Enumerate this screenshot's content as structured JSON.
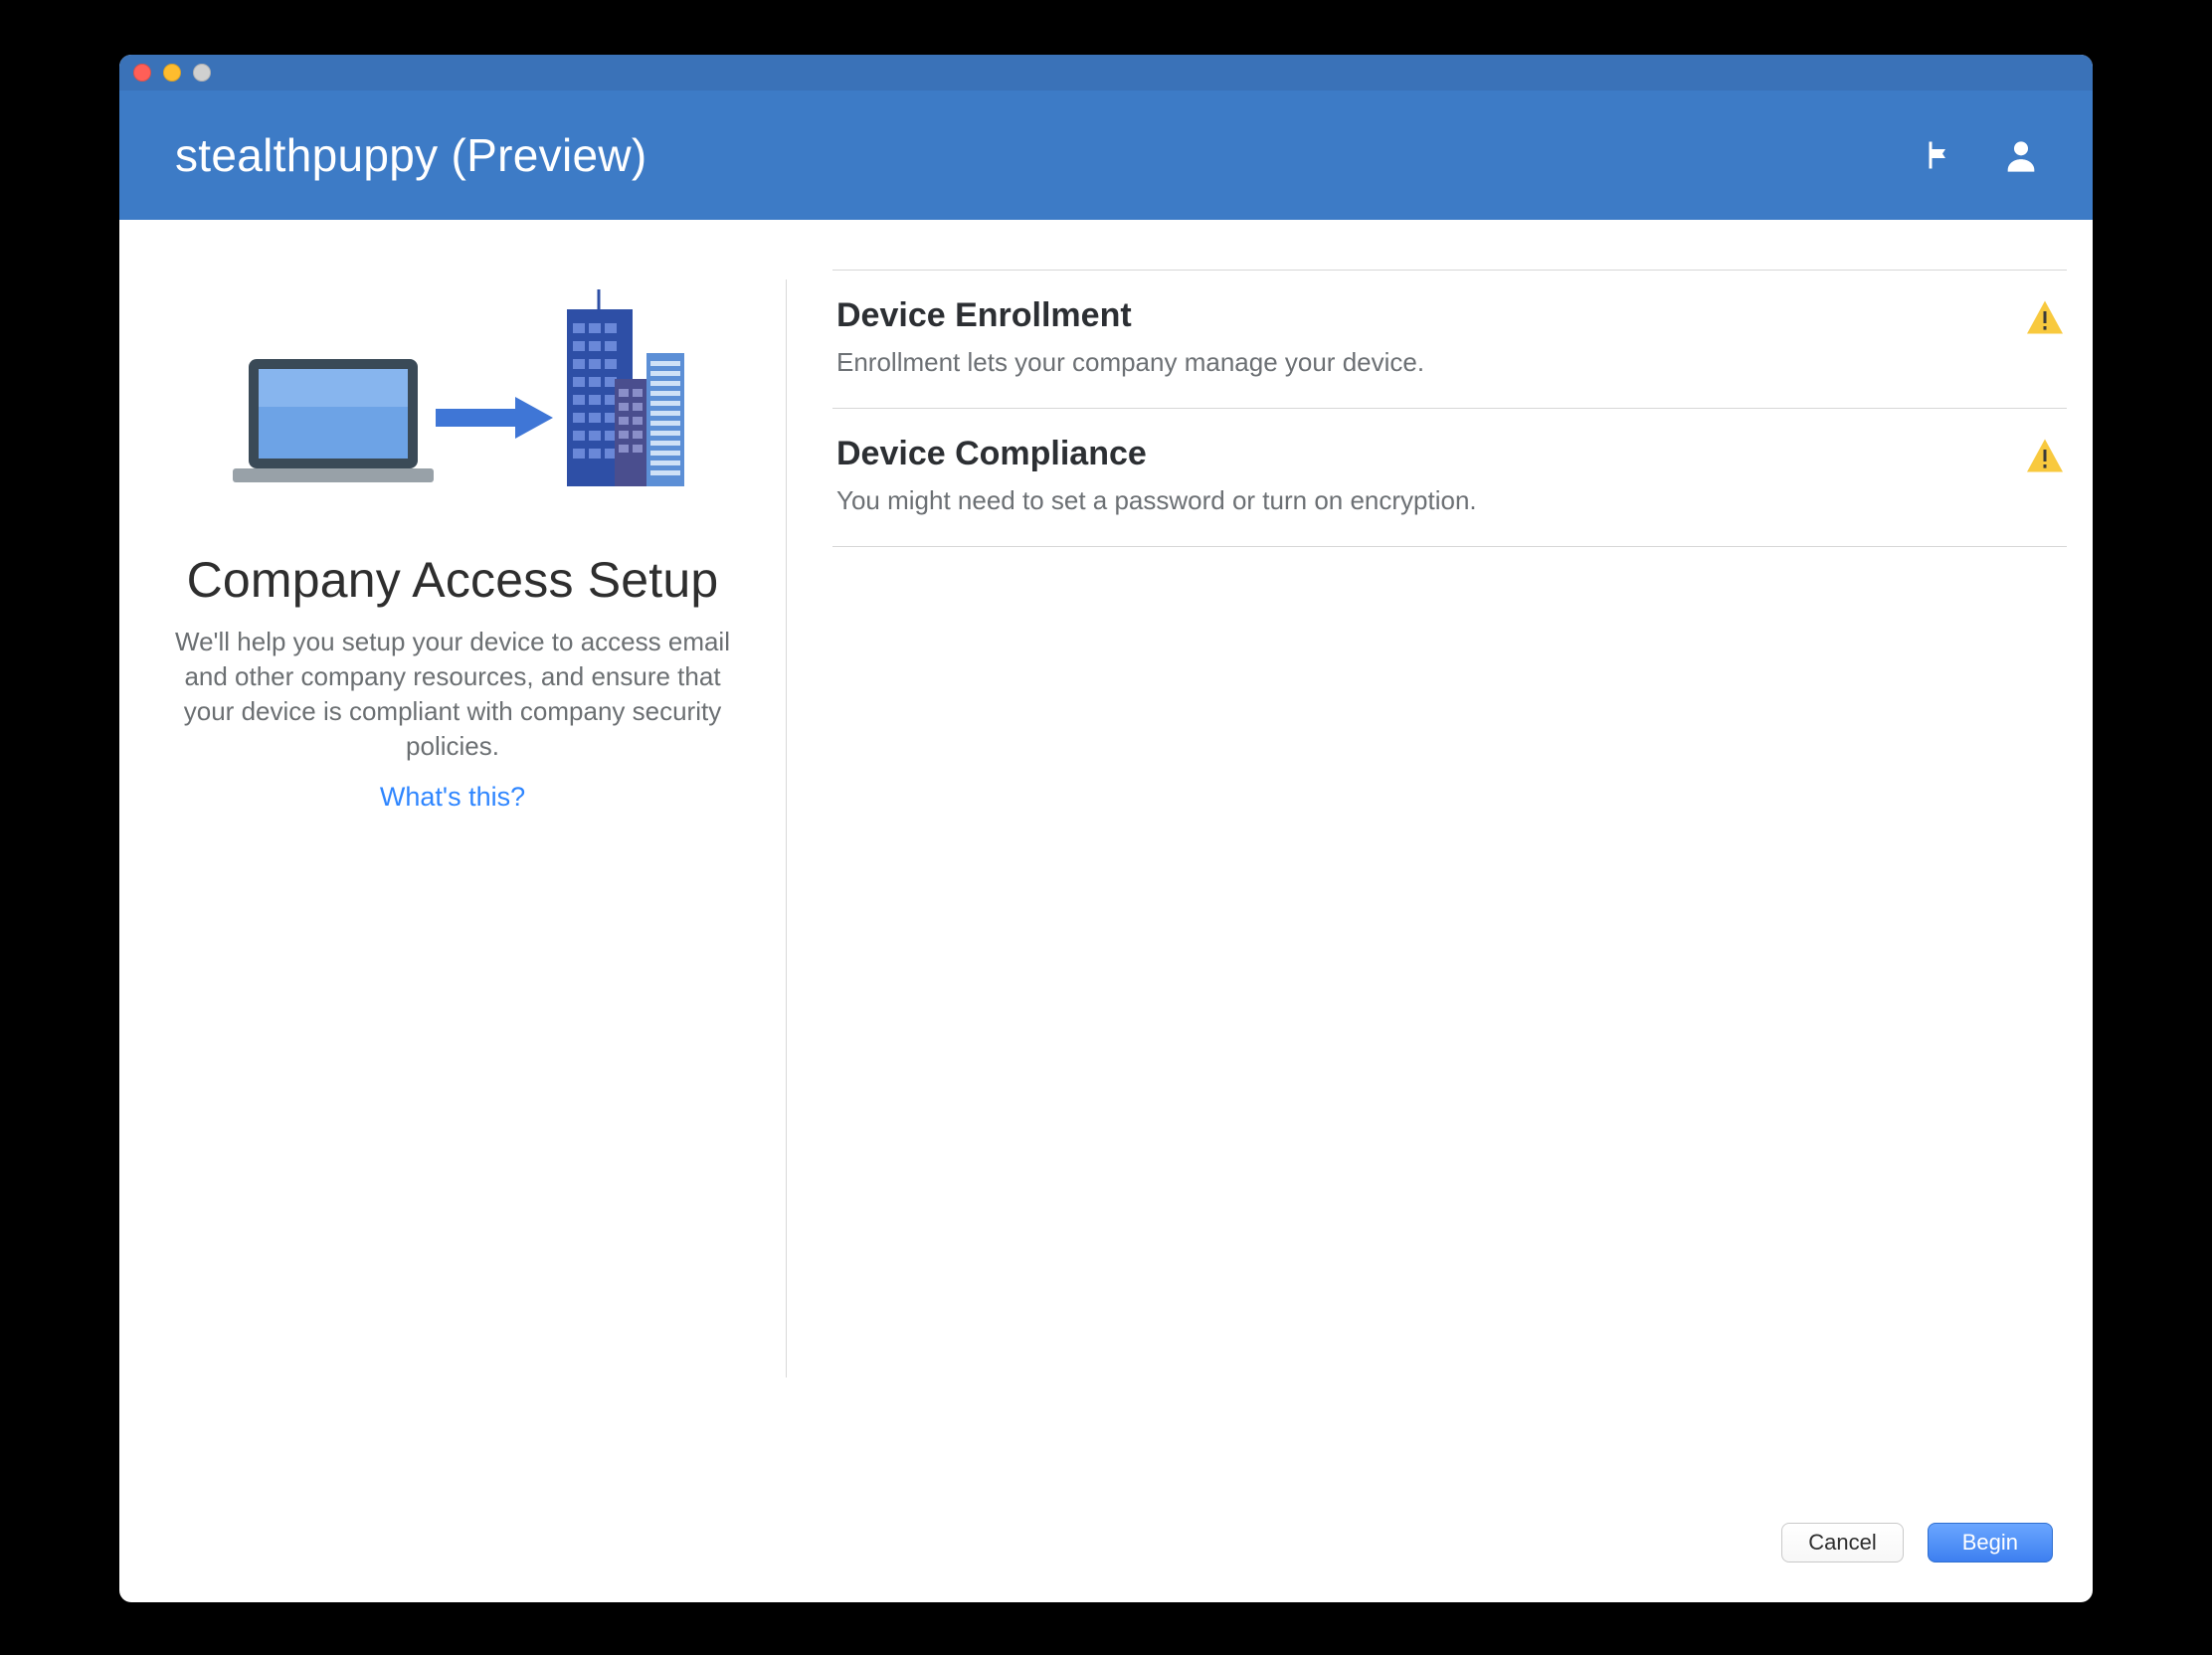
{
  "window": {
    "title": "stealthpuppy (Preview)"
  },
  "header": {
    "icons": {
      "flag": "flag-icon",
      "user": "user-icon"
    }
  },
  "left": {
    "title": "Company Access Setup",
    "description": "We'll help you setup your device to access email and other company resources, and ensure that your device is compliant with company security policies.",
    "help_link": "What's this?"
  },
  "sections": [
    {
      "title": "Device Enrollment",
      "subtitle": "Enrollment lets your company manage your device.",
      "status": "warning"
    },
    {
      "title": "Device Compliance",
      "subtitle": "You might need to set a password or turn on encryption.",
      "status": "warning"
    }
  ],
  "footer": {
    "cancel_label": "Cancel",
    "begin_label": "Begin"
  },
  "colors": {
    "header_bg": "#3d7bc6",
    "primary_btn": "#3d7ff0",
    "link": "#2f86ff",
    "warning": "#f8c93e"
  }
}
